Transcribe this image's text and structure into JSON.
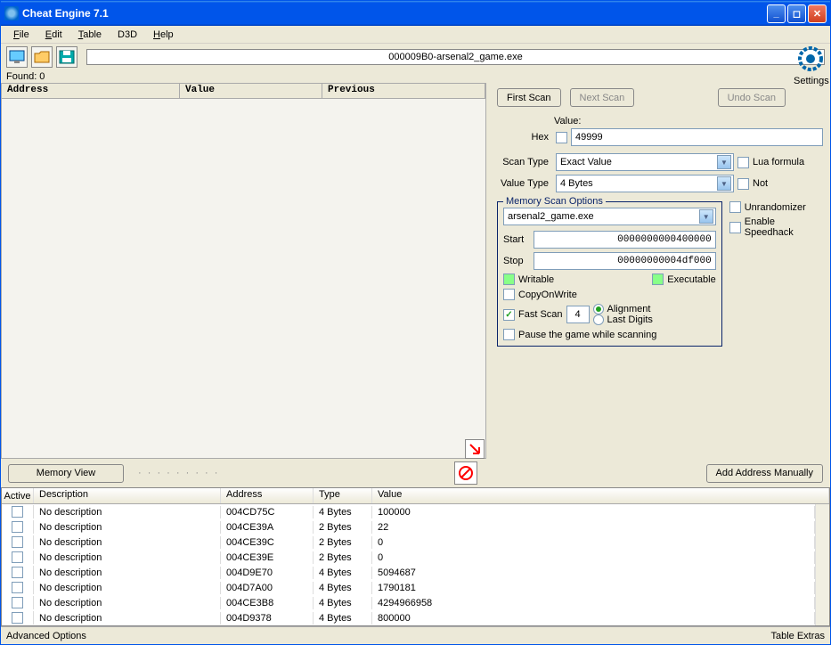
{
  "title": "Cheat Engine 7.1",
  "menu": {
    "file": "File",
    "edit": "Edit",
    "table": "Table",
    "d3d": "D3D",
    "help": "Help"
  },
  "process": "000009B0-arsenal2_game.exe",
  "found_label": "Found: 0",
  "settings_label": "Settings",
  "results_cols": {
    "address": "Address",
    "value": "Value",
    "previous": "Previous"
  },
  "buttons": {
    "first_scan": "First Scan",
    "next_scan": "Next Scan",
    "undo_scan": "Undo Scan",
    "memory_view": "Memory View",
    "add_manually": "Add Address Manually",
    "advanced": "Advanced Options",
    "table_extras": "Table Extras"
  },
  "labels": {
    "value": "Value:",
    "hex": "Hex",
    "scan_type": "Scan Type",
    "value_type": "Value Type",
    "lua": "Lua formula",
    "not": "Not",
    "memopts": "Memory Scan Options",
    "start": "Start",
    "stop": "Stop",
    "writable": "Writable",
    "executable": "Executable",
    "cow": "CopyOnWrite",
    "fast_scan": "Fast Scan",
    "alignment": "Alignment",
    "last_digits": "Last Digits",
    "pause": "Pause the game while scanning",
    "unrandomizer": "Unrandomizer",
    "speedhack": "Enable Speedhack"
  },
  "inputs": {
    "value": "49999",
    "scan_type": "Exact Value",
    "value_type": "4 Bytes",
    "mem_target": "arsenal2_game.exe",
    "start": "0000000000400000",
    "stop": "00000000004df000",
    "fast_scan": "4"
  },
  "addrlist_cols": {
    "active": "Active",
    "desc": "Description",
    "address": "Address",
    "type": "Type",
    "value": "Value"
  },
  "addrlist": [
    {
      "desc": "No description",
      "addr": "004CD75C",
      "type": "4 Bytes",
      "value": "100000"
    },
    {
      "desc": "No description",
      "addr": "004CE39A",
      "type": "2 Bytes",
      "value": "22"
    },
    {
      "desc": "No description",
      "addr": "004CE39C",
      "type": "2 Bytes",
      "value": "0"
    },
    {
      "desc": "No description",
      "addr": "004CE39E",
      "type": "2 Bytes",
      "value": "0"
    },
    {
      "desc": "No description",
      "addr": "004D9E70",
      "type": "4 Bytes",
      "value": "5094687"
    },
    {
      "desc": "No description",
      "addr": "004D7A00",
      "type": "4 Bytes",
      "value": "1790181"
    },
    {
      "desc": "No description",
      "addr": "004CE3B8",
      "type": "4 Bytes",
      "value": "4294966958"
    },
    {
      "desc": "No description",
      "addr": "004D9378",
      "type": "4 Bytes",
      "value": "800000"
    }
  ]
}
